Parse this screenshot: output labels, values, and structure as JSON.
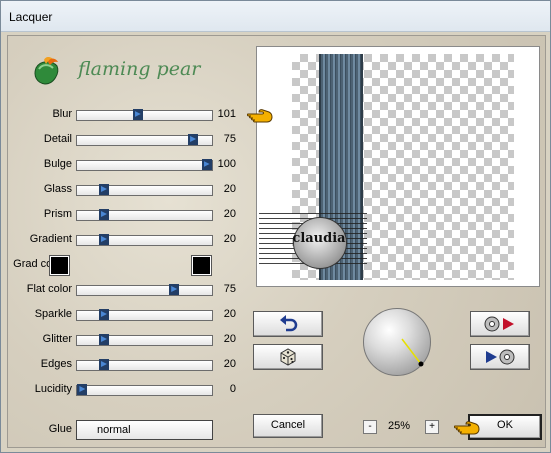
{
  "window": {
    "title": "Lacquer"
  },
  "brand": {
    "name": "flaming pear"
  },
  "sliders": [
    {
      "label": "Blur",
      "value": "101",
      "fraction": 0.45
    },
    {
      "label": "Detail",
      "value": "75",
      "fraction": 0.86
    },
    {
      "label": "Bulge",
      "value": "100",
      "fraction": 0.96
    },
    {
      "label": "Glass",
      "value": "20",
      "fraction": 0.2
    },
    {
      "label": "Prism",
      "value": "20",
      "fraction": 0.2
    },
    {
      "label": "Gradient",
      "value": "20",
      "fraction": 0.2
    }
  ],
  "grad_colors": {
    "label": "Grad colors",
    "color1": "#000000",
    "color2": "#000000"
  },
  "sliders2": [
    {
      "label": "Flat color",
      "value": "75",
      "fraction": 0.72
    },
    {
      "label": "Sparkle",
      "value": "20",
      "fraction": 0.2
    },
    {
      "label": "Glitter",
      "value": "20",
      "fraction": 0.2
    },
    {
      "label": "Edges",
      "value": "20",
      "fraction": 0.2
    },
    {
      "label": "Lucidity",
      "value": "0",
      "fraction": 0.0
    }
  ],
  "glue": {
    "label": "Glue",
    "value": "normal"
  },
  "buttons": {
    "cancel": "Cancel",
    "ok": "OK"
  },
  "zoom": {
    "minus": "-",
    "plus": "+",
    "level": "25%"
  },
  "preview": {
    "stamp_text": "claudia"
  },
  "icons": {
    "undo": "undo-icon",
    "dice": "random-dice-icon",
    "load": "load-preset-icon",
    "save": "save-preset-icon",
    "hand": "pointing-hand-icon",
    "logo": "flaming-pear-logo-icon"
  },
  "colors": {
    "accent": "#1c4fa0",
    "brand_green": "#4d8a54",
    "marker": "#f4b000"
  }
}
